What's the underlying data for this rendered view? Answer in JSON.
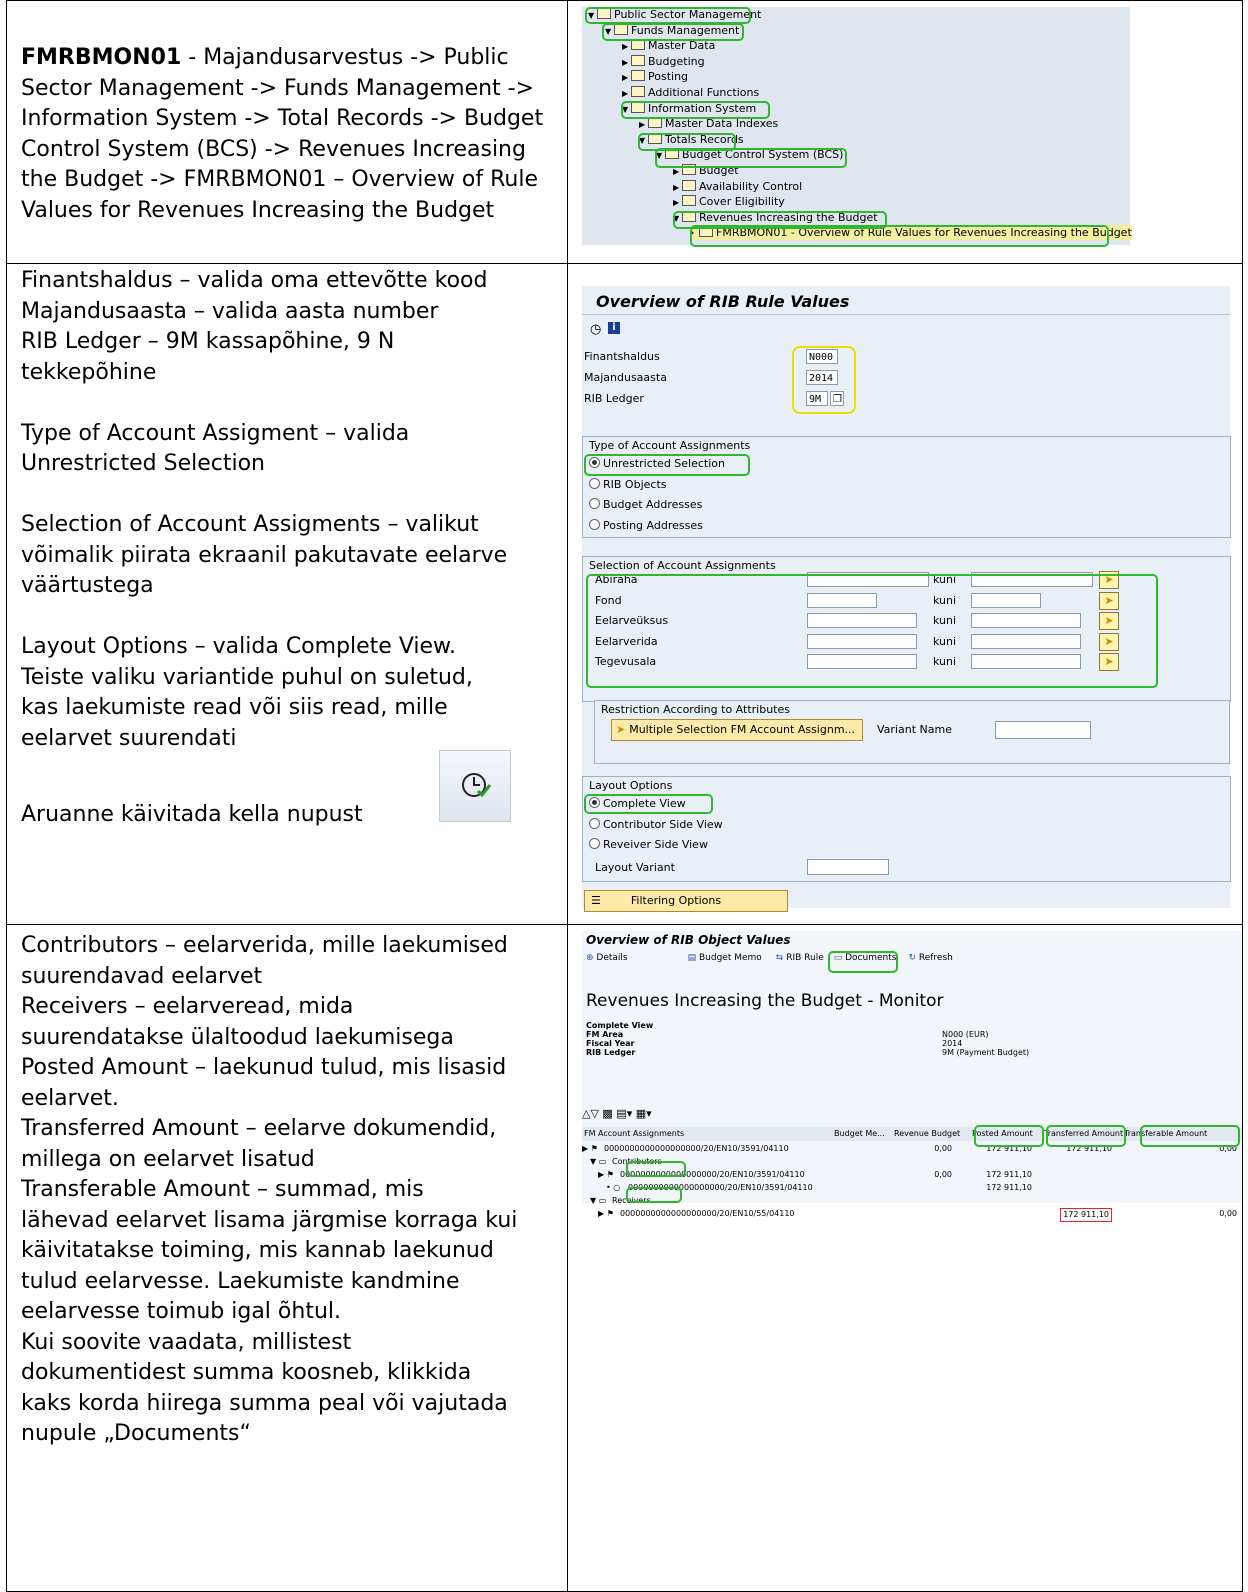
{
  "row1": {
    "code": "FMRBMON01",
    "path": " - Majandusarvestus -> Public Sector Management -> Funds Management -> Information System -> Total Records -> Budget Control System (BCS) -> Revenues Increasing the Budget -> FMRBMON01 – Overview of Rule Values for Revenues Increasing the Budget",
    "tree": {
      "items": [
        {
          "label": "Public Sector Management",
          "level": 0,
          "open": true
        },
        {
          "label": "Funds Management",
          "level": 1,
          "open": true
        },
        {
          "label": "Master Data",
          "level": 2,
          "open": false
        },
        {
          "label": "Budgeting",
          "level": 2,
          "open": false
        },
        {
          "label": "Posting",
          "level": 2,
          "open": false
        },
        {
          "label": "Additional Functions",
          "level": 2,
          "open": false
        },
        {
          "label": "Information System",
          "level": 2,
          "open": true
        },
        {
          "label": "Master Data Indexes",
          "level": 3,
          "open": false
        },
        {
          "label": "Totals Records",
          "level": 3,
          "open": true
        },
        {
          "label": "Budget Control System (BCS)",
          "level": 4,
          "open": true
        },
        {
          "label": "Budget",
          "level": 5,
          "open": false
        },
        {
          "label": "Availability Control",
          "level": 5,
          "open": false
        },
        {
          "label": "Cover Eligibility",
          "level": 5,
          "open": false
        },
        {
          "label": "Revenues Increasing the Budget",
          "level": 5,
          "open": true
        },
        {
          "label": "FMRBMON01 - Overview of Rule Values for Revenues Increasing the Budget",
          "level": 6,
          "open": false
        }
      ]
    }
  },
  "row2": {
    "lines": [
      "Finantshaldus – valida oma ettevõtte kood",
      "Majandusaasta – valida aasta number",
      "RIB Ledger – 9M  kassapõhine, 9 N",
      "tekkepõhine",
      "",
      "Type of Account Assigment – valida",
      "Unrestricted Selection",
      "",
      "Selection of Account Assigments – valikut",
      "võimalik piirata ekraanil pakutavate eelarve",
      "väärtustega",
      "",
      "Layout Options – valida Complete View.",
      "Teiste valiku variantide puhul on suletud,",
      "kas laekumiste read või siis read, mille",
      "eelarvet suurendati"
    ],
    "last_line": "Aruanne käivitada kella nupust",
    "clock_icon": "execute-clock-icon",
    "screen": {
      "title": "Overview of RIB Rule Values",
      "params": [
        {
          "label": "Finantshaldus",
          "value": "N000"
        },
        {
          "label": "Majandusaasta",
          "value": "2014"
        },
        {
          "label": "RIB Ledger",
          "value": "9M"
        }
      ],
      "type_group": {
        "title": "Type of Account Assignments",
        "options": [
          "Unrestricted Selection",
          "RIB Objects",
          "Budget Addresses",
          "Posting Addresses"
        ],
        "selected": "Unrestricted Selection"
      },
      "selection_group": {
        "title": "Selection of Account Assignments",
        "rows": [
          "Abiraha",
          "Fond",
          "Eelarveüksus",
          "Eelarverida",
          "Tegevusala"
        ],
        "kuni": "kuni"
      },
      "restriction": {
        "title": "Restriction According to Attributes",
        "button": "Multiple Selection FM Account Assignm...",
        "variant_label": "Variant Name"
      },
      "layout_group": {
        "title": "Layout Options",
        "options": [
          "Complete View",
          "Contributor Side View",
          "Reveiver Side View"
        ],
        "selected": "Complete View",
        "variant_label": "Layout Variant"
      },
      "filter_button": "Filtering Options"
    }
  },
  "row3": {
    "lines": [
      "Contributors – eelarverida, mille laekumised",
      "suurendavad eelarvet",
      "Receivers – eelarveread, mida",
      "suurendatakse ülaltoodud laekumisega",
      "Posted Amount – laekunud tulud, mis lisasid",
      "eelarvet.",
      "Transferred Amount – eelarve dokumendid,",
      "millega on eelarvet lisatud",
      "Transferable Amount – summad, mis",
      "lähevad eelarvet lisama järgmise korraga kui",
      "käivitatakse toiming, mis kannab laekunud",
      "tulud eelarvesse. Laekumiste kandmine",
      "eelarvesse toimub igal õhtul.",
      "Kui soovite vaadata, millistest",
      "dokumentidest summa koosneb, klikkida",
      "kaks korda hiirega summa peal või vajutada",
      "nupule „Documents“"
    ],
    "screen": {
      "title": "Overview of RIB Object Values",
      "toolbar": [
        "Details",
        "Budget Memo",
        "RIB Rule",
        "Documents",
        "Refresh"
      ],
      "heading": "Revenues Increasing the Budget - Monitor",
      "info_labels": [
        "Complete View",
        "FM Area",
        "Fiscal Year",
        "RIB Ledger"
      ],
      "info_values": [
        "",
        "N000 (EUR)",
        "2014",
        "9M (Payment Budget)"
      ],
      "columns": [
        "FM Account Assignments",
        "Budget Me...",
        "Revenue Budget",
        "Posted Amount",
        "Transferred Amount",
        "Transferable Amount"
      ],
      "rows": [
        {
          "label": "0000000000000000000/20/EN10/3591/04110",
          "budget_memo": "",
          "revenue_budget": "0,00",
          "posted": "172 911,10",
          "transferred": "172 911,10",
          "transferable": "0,00"
        },
        {
          "label": "Contributors",
          "budget_memo": "",
          "revenue_budget": "",
          "posted": "",
          "transferred": "",
          "transferable": ""
        },
        {
          "label": "0000000000000000000/20/EN10/3591/04110",
          "budget_memo": "",
          "revenue_budget": "0,00",
          "posted": "172 911,10",
          "transferred": "",
          "transferable": ""
        },
        {
          "label": "0000000000000000000/20/EN10/3591/04110",
          "budget_memo": "",
          "revenue_budget": "",
          "posted": "172 911,10",
          "transferred": "",
          "transferable": ""
        },
        {
          "label": "Receivers",
          "budget_memo": "",
          "revenue_budget": "",
          "posted": "",
          "transferred": "",
          "transferable": ""
        },
        {
          "label": "0000000000000000000/20/EN10/55/04110",
          "budget_memo": "",
          "revenue_budget": "",
          "posted": "",
          "transferred": "172 911,10",
          "transferable": "0,00"
        }
      ]
    }
  }
}
